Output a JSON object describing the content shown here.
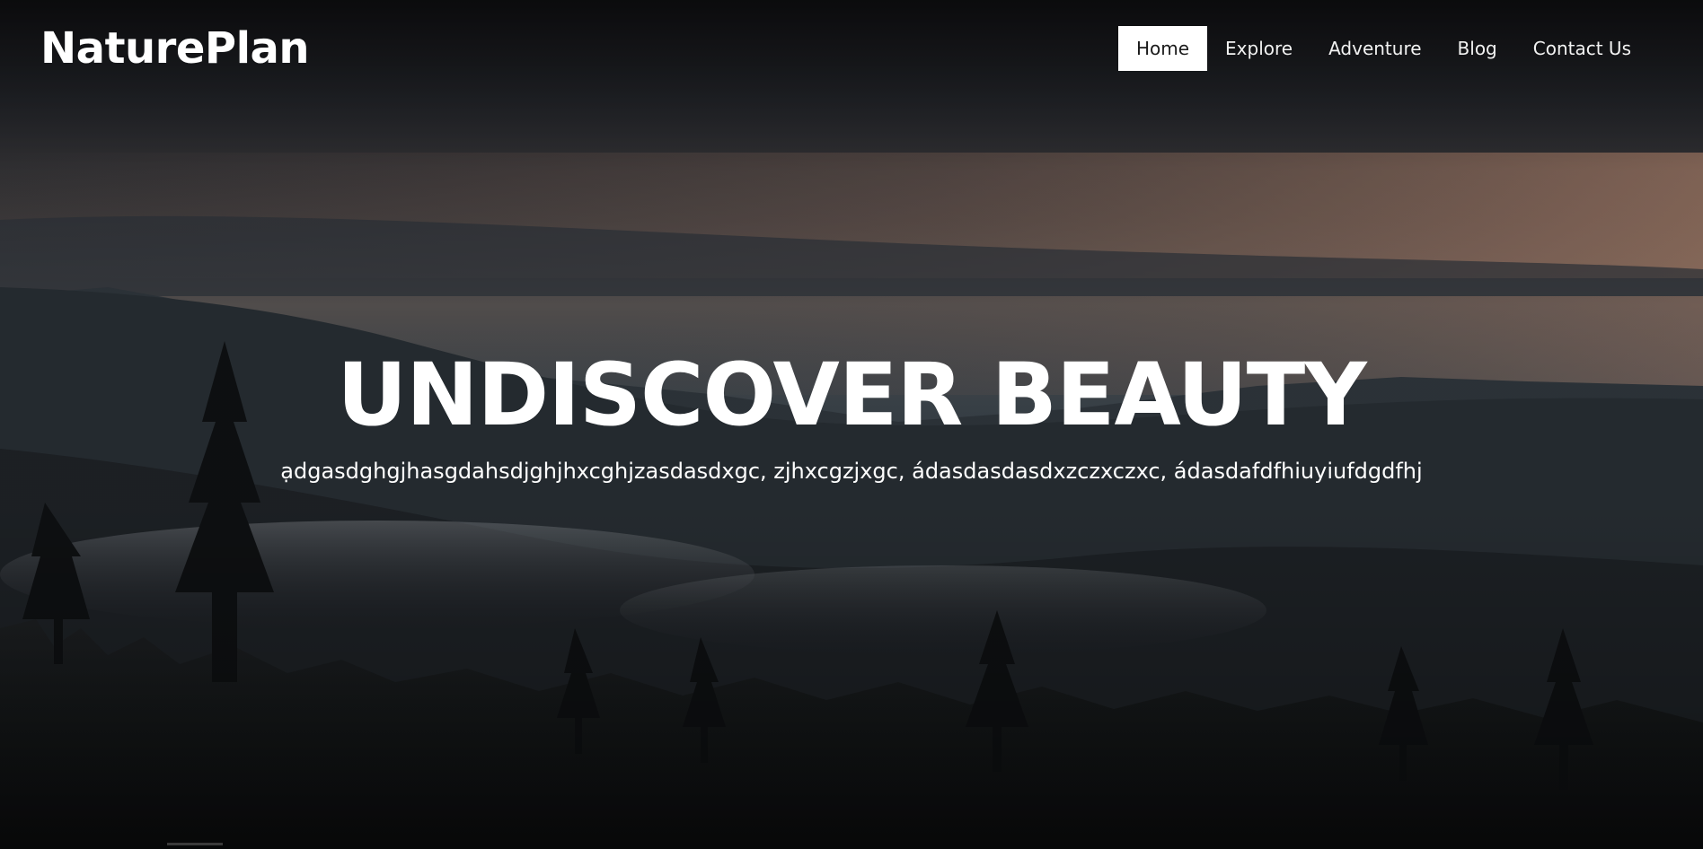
{
  "header": {
    "logo": "NaturePlan",
    "nav": [
      {
        "label": "Home",
        "active": true
      },
      {
        "label": "Explore",
        "active": false
      },
      {
        "label": "Adventure",
        "active": false
      },
      {
        "label": "Blog",
        "active": false
      },
      {
        "label": "Contact Us",
        "active": false
      }
    ]
  },
  "hero": {
    "title": "UNDISCOVER BEAUTY",
    "subtitle": "ạdgasdghgjhasgdahsdjghjhxcghjzasdasdxgc, zjhxcgzjxgc, ádasdasdasdxzczxczxc, ádasdafdfhiuyiufdgdfhj"
  },
  "colors": {
    "text": "#ffffff",
    "active_nav_bg": "#ffffff",
    "active_nav_text": "#1a1a1a"
  }
}
